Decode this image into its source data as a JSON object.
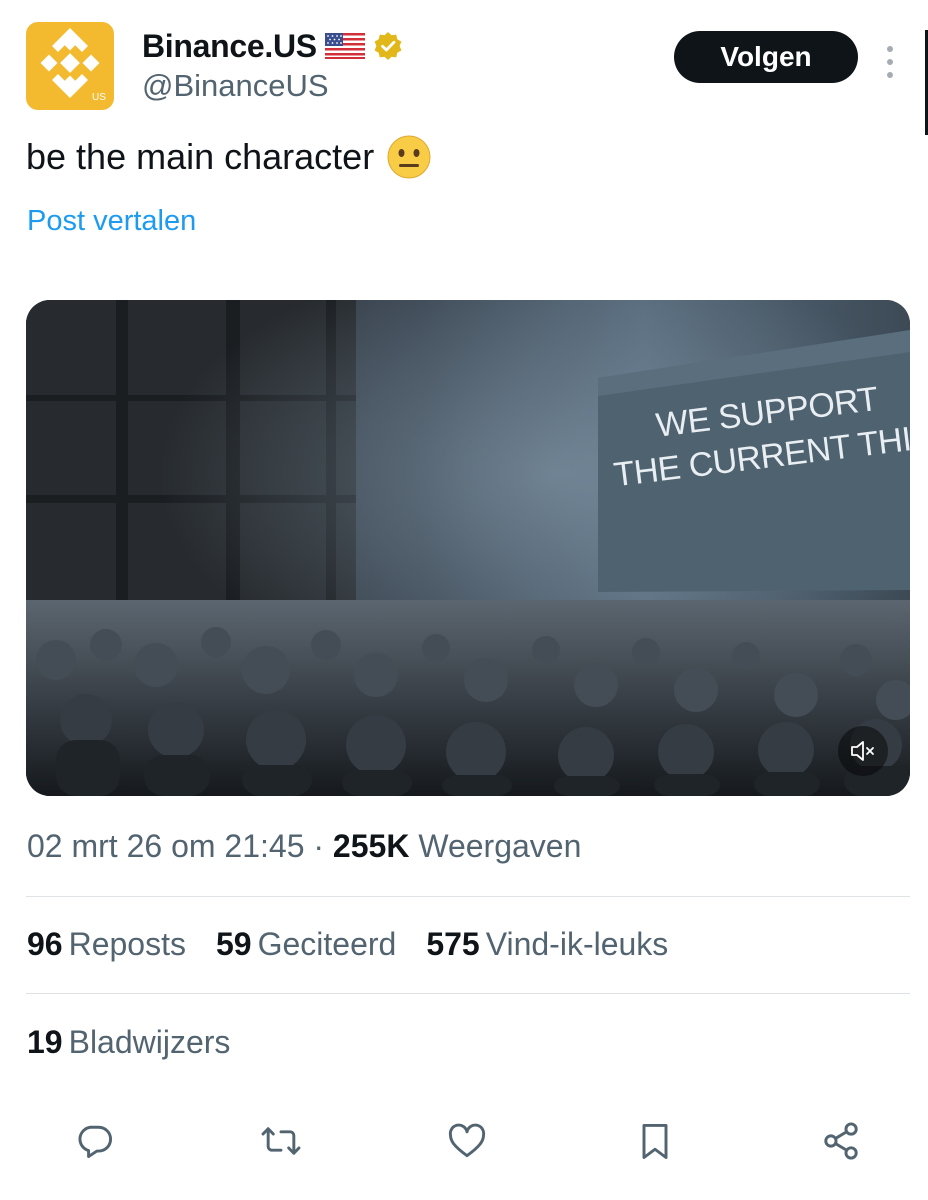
{
  "author": {
    "display_name": "Binance.US",
    "handle": "@BinanceUS",
    "flag_icon": "us-flag-icon",
    "verified_icon": "gold-verified-badge-icon",
    "avatar_text": "US",
    "avatar_color": "#f3ba2f"
  },
  "header": {
    "follow_label": "Volgen",
    "more_icon": "vertical-ellipsis-icon"
  },
  "tweet": {
    "text": "be the main character",
    "emoji_icon": "neutral-face-emoji",
    "translate_label": "Post vertalen"
  },
  "media": {
    "screen_line_1": "WE SUPPORT",
    "screen_line_2": "THE CURRENT THIN",
    "mute_icon": "speaker-muted-icon"
  },
  "meta": {
    "timestamp": "02 mrt 26 om 21:45",
    "separator": " · ",
    "views_count": "255K",
    "views_label": "Weergaven"
  },
  "stats": [
    {
      "count": "96",
      "label": "Reposts"
    },
    {
      "count": "59",
      "label": "Geciteerd"
    },
    {
      "count": "575",
      "label": "Vind-ik-leuks"
    }
  ],
  "bookmarks": {
    "count": "19",
    "label": "Bladwijzers"
  },
  "actions": [
    "reply-icon",
    "repost-icon",
    "like-icon",
    "bookmark-icon",
    "share-icon"
  ],
  "colors": {
    "link": "#1d9bf0",
    "text": "#0f1419",
    "secondary": "#536471",
    "verified_gold": "#e2b719"
  }
}
